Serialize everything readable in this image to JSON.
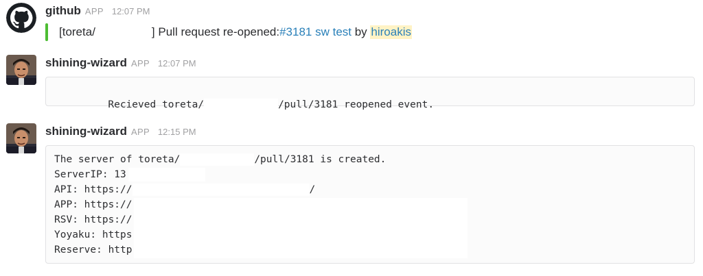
{
  "messages": [
    {
      "sender": "github",
      "badge": "APP",
      "time": "12:07 PM",
      "avatar_icon": "github-octocat-icon",
      "attachment": {
        "bar_color": "#4dbd33",
        "prefix": "[toreta/",
        "after_redaction": "] Pull request re-opened: ",
        "pr_link": "#3181 sw test",
        "by": " by ",
        "user_mention": "hiroakis"
      }
    },
    {
      "sender": "shining-wizard",
      "badge": "APP",
      "time": "12:07 PM",
      "avatar_icon": "user-avatar-icon",
      "code": {
        "part1": "Recieved toreta/",
        "part2": "/pull/3181 reopened event."
      }
    },
    {
      "sender": "shining-wizard",
      "badge": "APP",
      "time": "12:15 PM",
      "avatar_icon": "user-avatar-icon",
      "code_lines": [
        {
          "a": "The server of toreta/",
          "b": "/pull/3181 is created."
        },
        {
          "a": "ServerIP: 13.",
          "b": ""
        },
        {
          "a": "API: https://",
          "b": "/"
        },
        {
          "a": "APP: https://",
          "b": ""
        },
        {
          "a": "RSV: https://",
          "b": ""
        },
        {
          "a": "Yoyaku: https",
          "b": ""
        },
        {
          "a": "Reserve: http",
          "b": ""
        }
      ]
    }
  ],
  "colors": {
    "link": "#2a80b9",
    "mention_bg": "#fff3c5",
    "muted": "#a0a0a2"
  }
}
